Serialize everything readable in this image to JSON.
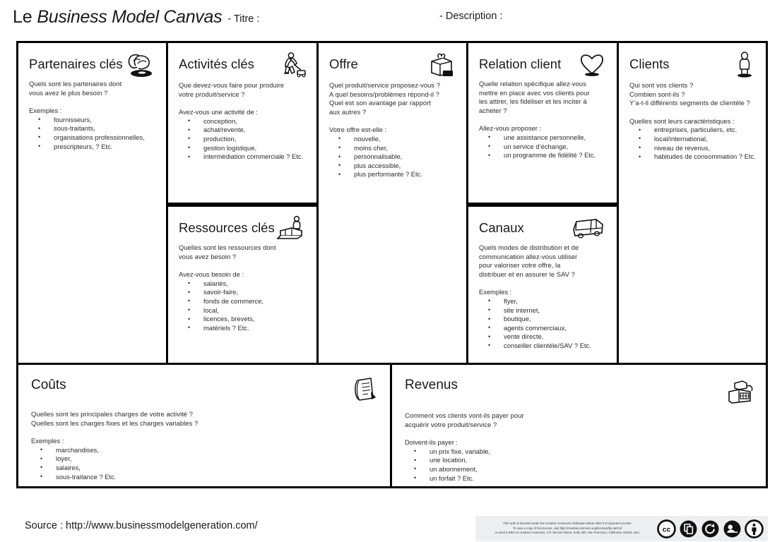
{
  "header": {
    "title_prefix": "Le",
    "title_main": "Business Model Canvas",
    "title_label": "- Titre :",
    "description_label": "- Description :"
  },
  "canvas": {
    "cells": [
      {
        "key": "partenaires",
        "title": "Partenaires clés",
        "icon": "handshake-partners-icon",
        "questions": [
          "Quels sont les partenaires dont",
          "vous avez le plus besoin ?"
        ],
        "list_label": "Exemples :",
        "bullets": [
          "fournisseurs,",
          "sous-traitants,",
          "organisations professionnelles,",
          "prescripteurs, ? Etc."
        ]
      },
      {
        "key": "activites",
        "title": "Activités clés",
        "icon": "worker-machine-icon",
        "questions": [
          "Que devez-vous faire pour produire",
          "votre produit/service ?"
        ],
        "list_label": "Avez-vous une activité de :",
        "bullets": [
          "conception,",
          "achat/revente,",
          "production,",
          "gestion logistique,",
          "intermédiation commerciale ? Etc."
        ]
      },
      {
        "key": "ressources",
        "title": "Ressources  clés",
        "icon": "worker-forklift-icon",
        "questions": [
          "Quelles sont les  ressources dont",
          "vous avez besoin ?"
        ],
        "list_label": "Avez-vous besoin de :",
        "bullets": [
          "salariés,",
          "savoir-faire,",
          "fonds de commerce,",
          "local,",
          "licences,  brevets,",
          "matériels ? Etc."
        ]
      },
      {
        "key": "offre",
        "title": "Offre",
        "icon": "gift-box-icon",
        "questions": [
          "Quel produit/service proposez-vous ?",
          "A quel besoins/problèmes répond-il ?",
          "Quel est son avantage par rapport",
          "aux autres ?"
        ],
        "list_label": "Votre offre est-elle :",
        "bullets": [
          "nouvelle,",
          "moins cher,",
          "personnalisable,",
          "plus accessible,",
          "plus performante ? Etc."
        ]
      },
      {
        "key": "relation",
        "title": "Relation client",
        "icon": "heart-icon",
        "questions": [
          "Quelle relation spécifique allez-vous",
          "mettre en place avec vos clients pour",
          "les attirer, les fidéliser et les inciter à",
          "acheter ?"
        ],
        "list_label": "Allez-vous proposer :",
        "bullets": [
          "une assistance personnelle,",
          "un service d’échange,",
          "un programme de fidélité  ? Etc."
        ]
      },
      {
        "key": "canaux",
        "title": "Canaux",
        "icon": "delivery-truck-icon",
        "questions": [
          "Quels modes de distribution et de",
          "communication allez-vous utiliser",
          "pour valoriser votre offre, la",
          "distribuer et en assurer le SAV ?"
        ],
        "list_label": "Exemples :",
        "bullets": [
          "flyer,",
          "site internet,",
          "boutique,",
          "agents commerciaux,",
          "vente directe,",
          "conseiller clientèle/SAV  ? Etc."
        ]
      },
      {
        "key": "clients",
        "title": "Clients",
        "icon": "standing-person-icon",
        "questions": [
          "Qui sont vos clients ?",
          "Combien sont-ils ?",
          "Y’a-t-il différents segments de clientèle ?"
        ],
        "list_label": "Quelles sont leurs caractéristiques :",
        "bullets": [
          "entreprises, particuliers, etc.",
          "local/international,",
          "niveau de revenus,",
          "habitudes de consommation ? Etc."
        ]
      },
      {
        "key": "couts",
        "title": "Coûts",
        "icon": "invoice-receipt-icon",
        "questions": [
          "Quelles sont les  principales charges de votre activité ?",
          "Quelles sont les  charges fixes et les charges variables ?"
        ],
        "list_label": "Exemples :",
        "bullets": [
          "marchandises,",
          "loyer,",
          "salaires,",
          "sous-traitance ? Etc."
        ]
      },
      {
        "key": "revenus",
        "title": "Revenus",
        "icon": "cash-register-icon",
        "questions": [
          "Comment vos clients vont-ils payer pour",
          "acquérir votre produit/service ?"
        ],
        "list_label": "Doivent-ils payer :",
        "bullets": [
          "un prix fixe,  variable,",
          "une location,",
          "un abonnement,",
          "un forfait  ? Etc."
        ]
      }
    ]
  },
  "footer": {
    "source": "Source : http://www.businessmodelgeneration.com/",
    "license_lines": [
      "This work is licensed under the Creative Commons Attribution-Share Alike 3.0 Unported License.",
      "To view a copy of this license, visit http://creativecommons.org/licenses/by-sa/3.0/",
      "or send a letter to Creative Commons, 171 Second Street, Suite 300, San Francisco, California, 94105, USA."
    ],
    "badges": [
      "creative-commons-icon",
      "copy-share-icon",
      "share-alike-icon",
      "remix-icon",
      "attribution-person-icon"
    ]
  },
  "colors": {
    "border": "#000000",
    "text": "#1a1a1a",
    "body_text": "#2b2b2b",
    "license_bg": "#eceff1"
  }
}
